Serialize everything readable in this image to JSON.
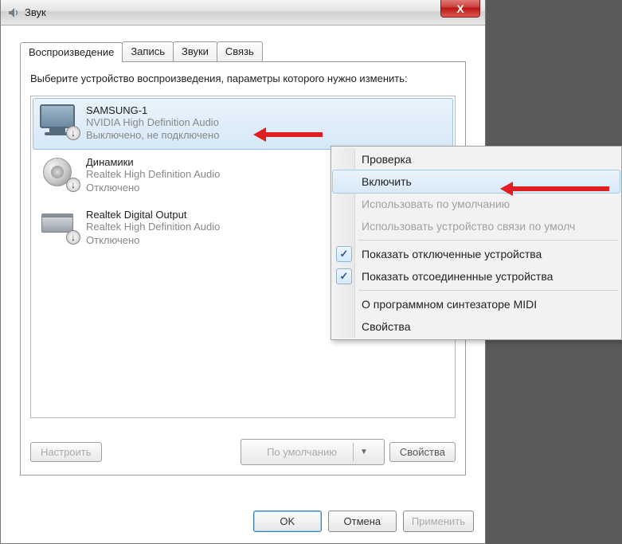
{
  "window": {
    "title": "Звук",
    "close_label": "X"
  },
  "tabs": {
    "playback": "Воспроизведение",
    "recording": "Запись",
    "sounds": "Звуки",
    "comm": "Связь"
  },
  "instruction": "Выберите устройство воспроизведения, параметры которого нужно изменить:",
  "devices": [
    {
      "name": "SAMSUNG-1",
      "driver": "NVIDIA High Definition Audio",
      "status": "Выключено, не подключено"
    },
    {
      "name": "Динамики",
      "driver": "Realtek High Definition Audio",
      "status": "Отключено"
    },
    {
      "name": "Realtek Digital Output",
      "driver": "Realtek High Definition Audio",
      "status": "Отключено"
    }
  ],
  "panel_buttons": {
    "configure": "Настроить",
    "default": "По умолчанию",
    "properties": "Свойства"
  },
  "dialog_buttons": {
    "ok": "OK",
    "cancel": "Отмена",
    "apply": "Применить"
  },
  "context_menu": {
    "test": "Проверка",
    "enable": "Включить",
    "set_default": "Использовать по умолчанию",
    "set_comm": "Использовать устройство связи по умолч",
    "show_disabled": "Показать отключенные устройства",
    "show_disconnected": "Показать отсоединенные устройства",
    "about_midi": "О программном синтезаторе MIDI",
    "properties": "Свойства"
  }
}
